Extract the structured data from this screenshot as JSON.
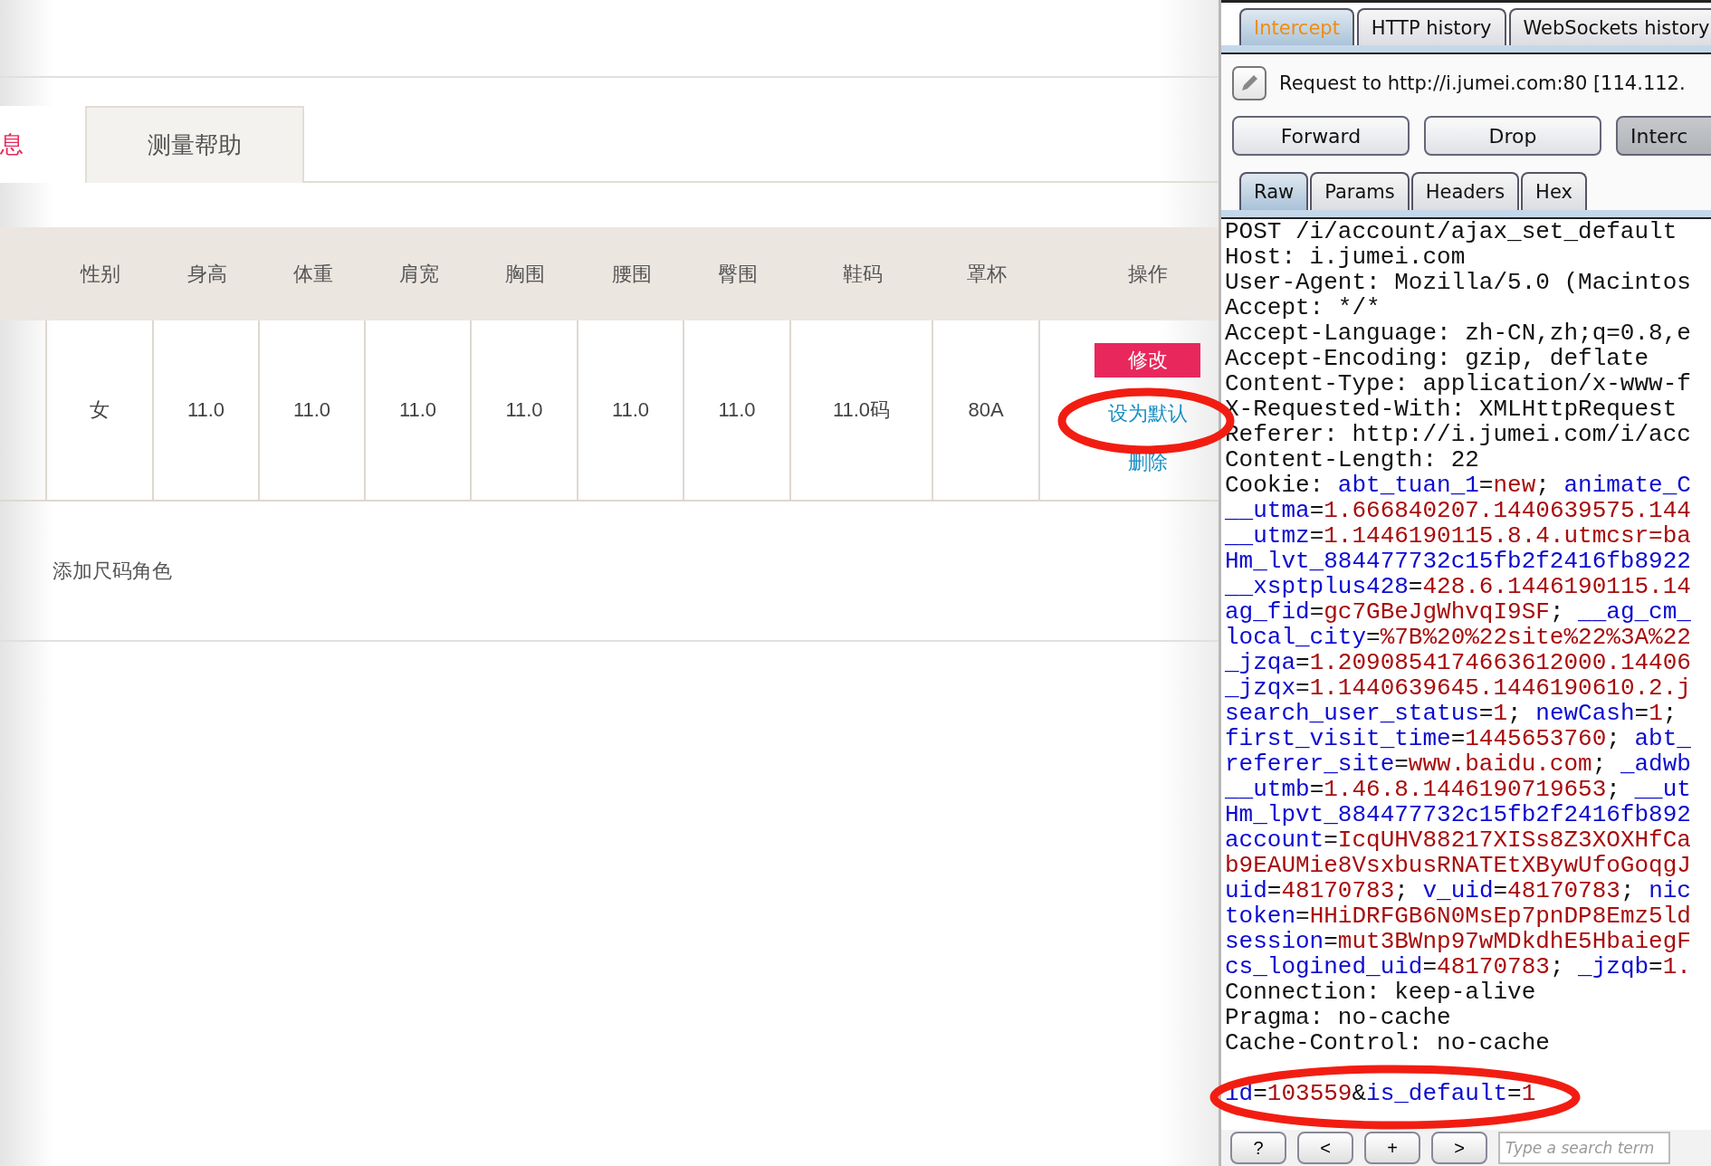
{
  "page": {
    "tabs": [
      {
        "label": "息",
        "selected": true
      },
      {
        "label": "测量帮助",
        "selected": false
      }
    ],
    "table": {
      "columns": [
        "性别",
        "身高",
        "体重",
        "肩宽",
        "胸围",
        "腰围",
        "臀围",
        "鞋码",
        "罩杯",
        "操作"
      ],
      "rows": [
        {
          "cells": [
            "女",
            "11.0",
            "11.0",
            "11.0",
            "11.0",
            "11.0",
            "11.0",
            "11.0码",
            "80A"
          ],
          "actions": [
            {
              "label": "修改",
              "kind": "button"
            },
            {
              "label": "设为默认",
              "kind": "link"
            },
            {
              "label": "删除",
              "kind": "link"
            }
          ]
        }
      ]
    },
    "add_link": "添加尺码角色"
  },
  "proxy": {
    "tabs": [
      {
        "label": "Intercept",
        "selected": true
      },
      {
        "label": "HTTP history",
        "selected": false
      },
      {
        "label": "WebSockets history",
        "selected": false
      }
    ],
    "request_info": "Request to http://i.jumei.com:80  [114.112.",
    "buttons": [
      {
        "label": "Forward",
        "pressed": false
      },
      {
        "label": "Drop",
        "pressed": false
      },
      {
        "label": "Interc",
        "pressed": true
      }
    ],
    "view_tabs": [
      {
        "label": "Raw",
        "selected": true
      },
      {
        "label": "Params",
        "selected": false
      },
      {
        "label": "Headers",
        "selected": false
      },
      {
        "label": "Hex",
        "selected": false
      }
    ],
    "lines": [
      {
        "kind": "text",
        "parts": [
          {
            "t": "POST /i/account/ajax_set_default",
            "kind": "plain"
          }
        ]
      },
      {
        "kind": "text",
        "parts": [
          {
            "t": "Host: i.jumei.com",
            "kind": "plain"
          }
        ]
      },
      {
        "kind": "text",
        "parts": [
          {
            "t": "User-Agent: Mozilla/5.0 (Macintos",
            "kind": "plain"
          }
        ]
      },
      {
        "kind": "text",
        "parts": [
          {
            "t": "Accept: */*",
            "kind": "plain"
          }
        ]
      },
      {
        "kind": "text",
        "parts": [
          {
            "t": "Accept-Language: zh-CN,zh;q=0.8,e",
            "kind": "plain"
          }
        ]
      },
      {
        "kind": "text",
        "parts": [
          {
            "t": "Accept-Encoding: gzip, deflate",
            "kind": "plain"
          }
        ]
      },
      {
        "kind": "text",
        "parts": [
          {
            "t": "Content-Type: application/x-www-f",
            "kind": "plain"
          }
        ]
      },
      {
        "kind": "text",
        "parts": [
          {
            "t": "X-Requested-With: XMLHttpRequest",
            "kind": "plain"
          }
        ]
      },
      {
        "kind": "text",
        "parts": [
          {
            "t": "Referer: http://i.jumei.com/i/acc",
            "kind": "plain"
          }
        ]
      },
      {
        "kind": "text",
        "parts": [
          {
            "t": "Content-Length: 22",
            "kind": "plain"
          }
        ]
      },
      {
        "kind": "text",
        "parts": [
          {
            "t": "Cookie: ",
            "kind": "plain"
          },
          {
            "t": "abt_tuan_1",
            "kind": "key"
          },
          {
            "t": "=",
            "kind": "plain"
          },
          {
            "t": "new",
            "kind": "value"
          },
          {
            "t": "; ",
            "kind": "plain"
          },
          {
            "t": "animate_C",
            "kind": "key"
          }
        ]
      },
      {
        "kind": "text",
        "parts": [
          {
            "t": "__utma",
            "kind": "key"
          },
          {
            "t": "=",
            "kind": "plain"
          },
          {
            "t": "1.666840207.1440639575.144",
            "kind": "value"
          }
        ]
      },
      {
        "kind": "text",
        "parts": [
          {
            "t": "__utmz",
            "kind": "key"
          },
          {
            "t": "=",
            "kind": "plain"
          },
          {
            "t": "1.1446190115.8.4.utmcsr=ba",
            "kind": "value"
          }
        ]
      },
      {
        "kind": "text",
        "parts": [
          {
            "t": "Hm_lvt_884477732c15fb2f2416fb8922",
            "kind": "key"
          }
        ]
      },
      {
        "kind": "text",
        "parts": [
          {
            "t": "__xsptplus428",
            "kind": "key"
          },
          {
            "t": "=",
            "kind": "plain"
          },
          {
            "t": "428.6.1446190115.14",
            "kind": "value"
          }
        ]
      },
      {
        "kind": "text",
        "parts": [
          {
            "t": "ag_fid",
            "kind": "key"
          },
          {
            "t": "=",
            "kind": "plain"
          },
          {
            "t": "gc7GBeJgWhvqI9SF",
            "kind": "value"
          },
          {
            "t": "; ",
            "kind": "plain"
          },
          {
            "t": "__ag_cm_",
            "kind": "key"
          }
        ]
      },
      {
        "kind": "text",
        "parts": [
          {
            "t": "local_city",
            "kind": "key"
          },
          {
            "t": "=",
            "kind": "plain"
          },
          {
            "t": "%7B%20%22site%22%3A%22",
            "kind": "value"
          }
        ]
      },
      {
        "kind": "text",
        "parts": [
          {
            "t": "_jzqa",
            "kind": "key"
          },
          {
            "t": "=",
            "kind": "plain"
          },
          {
            "t": "1.2090854174663612000.14406",
            "kind": "value"
          }
        ]
      },
      {
        "kind": "text",
        "parts": [
          {
            "t": "_jzqx",
            "kind": "key"
          },
          {
            "t": "=",
            "kind": "plain"
          },
          {
            "t": "1.1440639645.1446190610.2.j",
            "kind": "value"
          }
        ]
      },
      {
        "kind": "text",
        "parts": [
          {
            "t": "search_user_status",
            "kind": "key"
          },
          {
            "t": "=",
            "kind": "plain"
          },
          {
            "t": "1",
            "kind": "value"
          },
          {
            "t": "; ",
            "kind": "plain"
          },
          {
            "t": "newCash",
            "kind": "key"
          },
          {
            "t": "=",
            "kind": "plain"
          },
          {
            "t": "1",
            "kind": "value"
          },
          {
            "t": ";",
            "kind": "plain"
          }
        ]
      },
      {
        "kind": "text",
        "parts": [
          {
            "t": "first_visit_time",
            "kind": "key"
          },
          {
            "t": "=",
            "kind": "plain"
          },
          {
            "t": "1445653760",
            "kind": "value"
          },
          {
            "t": "; ",
            "kind": "plain"
          },
          {
            "t": "abt_",
            "kind": "key"
          }
        ]
      },
      {
        "kind": "text",
        "parts": [
          {
            "t": "referer_site",
            "kind": "key"
          },
          {
            "t": "=",
            "kind": "plain"
          },
          {
            "t": "www.baidu.com",
            "kind": "value"
          },
          {
            "t": "; ",
            "kind": "plain"
          },
          {
            "t": "_adwb",
            "kind": "key"
          }
        ]
      },
      {
        "kind": "text",
        "parts": [
          {
            "t": "__utmb",
            "kind": "key"
          },
          {
            "t": "=",
            "kind": "plain"
          },
          {
            "t": "1.46.8.1446190719653",
            "kind": "value"
          },
          {
            "t": "; ",
            "kind": "plain"
          },
          {
            "t": "__ut",
            "kind": "key"
          }
        ]
      },
      {
        "kind": "text",
        "parts": [
          {
            "t": "Hm_lpvt_884477732c15fb2f2416fb892",
            "kind": "key"
          }
        ]
      },
      {
        "kind": "text",
        "parts": [
          {
            "t": "account",
            "kind": "key"
          },
          {
            "t": "=",
            "kind": "plain"
          },
          {
            "t": "IcqUHV88217XISs8Z3XOXHfCa",
            "kind": "value"
          }
        ]
      },
      {
        "kind": "text",
        "parts": [
          {
            "t": "b9EAUMie8VsxbusRNATEtXBywUfoGoqgJ",
            "kind": "value"
          }
        ]
      },
      {
        "kind": "text",
        "parts": [
          {
            "t": "uid",
            "kind": "key"
          },
          {
            "t": "=",
            "kind": "plain"
          },
          {
            "t": "48170783",
            "kind": "value"
          },
          {
            "t": "; ",
            "kind": "plain"
          },
          {
            "t": "v_uid",
            "kind": "key"
          },
          {
            "t": "=",
            "kind": "plain"
          },
          {
            "t": "48170783",
            "kind": "value"
          },
          {
            "t": "; ",
            "kind": "plain"
          },
          {
            "t": "nic",
            "kind": "key"
          }
        ]
      },
      {
        "kind": "text",
        "parts": [
          {
            "t": "token",
            "kind": "key"
          },
          {
            "t": "=",
            "kind": "plain"
          },
          {
            "t": "HHiDRFGB6N0MsEp7pnDP8Emz5ld",
            "kind": "value"
          }
        ]
      },
      {
        "kind": "text",
        "parts": [
          {
            "t": "session",
            "kind": "key"
          },
          {
            "t": "=",
            "kind": "plain"
          },
          {
            "t": "mut3BWnp97wMDkdhE5HbaiegF",
            "kind": "value"
          }
        ]
      },
      {
        "kind": "text",
        "parts": [
          {
            "t": "cs_logined_uid",
            "kind": "key"
          },
          {
            "t": "=",
            "kind": "plain"
          },
          {
            "t": "48170783",
            "kind": "value"
          },
          {
            "t": "; ",
            "kind": "plain"
          },
          {
            "t": "_jzqb",
            "kind": "key"
          },
          {
            "t": "=",
            "kind": "plain"
          },
          {
            "t": "1.",
            "kind": "value"
          }
        ]
      },
      {
        "kind": "text",
        "parts": [
          {
            "t": "Connection: keep-alive",
            "kind": "plain"
          }
        ]
      },
      {
        "kind": "text",
        "parts": [
          {
            "t": "Pragma: no-cache",
            "kind": "plain"
          }
        ]
      },
      {
        "kind": "text",
        "parts": [
          {
            "t": "Cache-Control: no-cache",
            "kind": "plain"
          }
        ]
      },
      {
        "kind": "blank"
      },
      {
        "kind": "text",
        "parts": [
          {
            "t": "id",
            "kind": "key"
          },
          {
            "t": "=",
            "kind": "plain"
          },
          {
            "t": "103559",
            "kind": "value"
          },
          {
            "t": "&",
            "kind": "plain"
          },
          {
            "t": "is_default",
            "kind": "key"
          },
          {
            "t": "=",
            "kind": "plain"
          },
          {
            "t": "1",
            "kind": "value"
          }
        ]
      }
    ],
    "nav_buttons": [
      "?",
      "<",
      "+",
      ">"
    ],
    "search": {
      "placeholder": "Type a search term"
    }
  },
  "annotations": [
    {
      "kind": "ellipse"
    },
    {
      "kind": "ellipse"
    }
  ]
}
